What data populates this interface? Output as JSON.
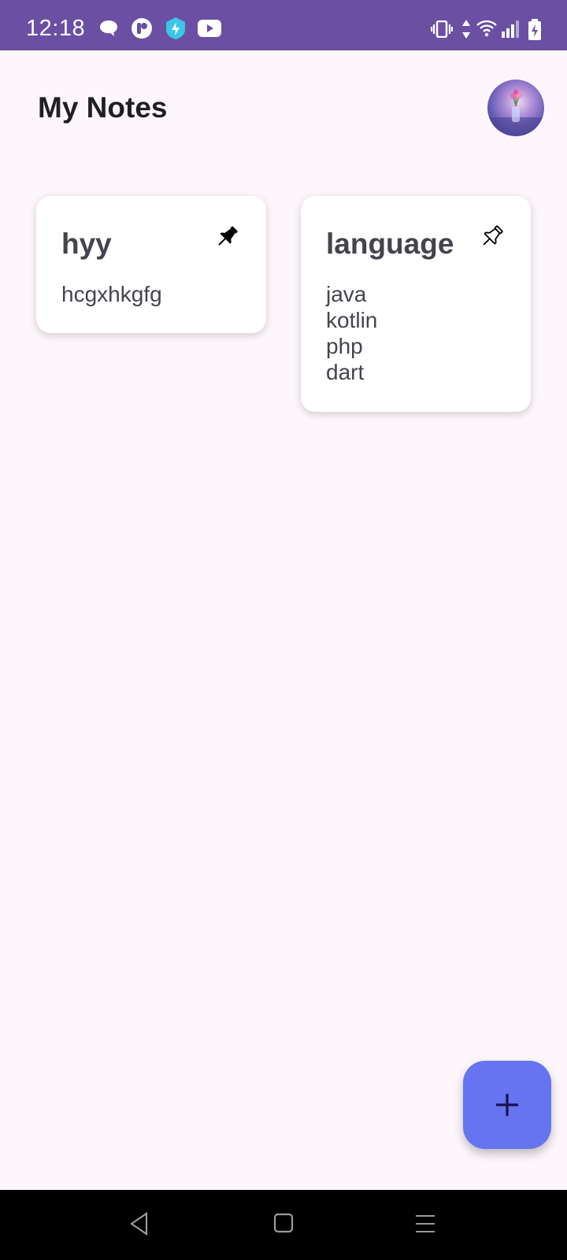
{
  "status_bar": {
    "time": "12:18",
    "left_icons": [
      "chat-bubble-icon",
      "p-app-icon",
      "bolt-shield-icon",
      "youtube-icon"
    ],
    "right_icons": [
      "vibrate-icon",
      "data-arrows-icon",
      "wifi-icon",
      "signal-icon",
      "battery-charging-icon"
    ]
  },
  "header": {
    "title": "My Notes",
    "avatar_icon": "profile-avatar"
  },
  "notes": [
    {
      "title": "hyy",
      "lines": [
        "hcgxhkgfg"
      ],
      "pinned": true
    },
    {
      "title": "language",
      "lines": [
        "java",
        "kotlin",
        "php",
        "dart"
      ],
      "pinned": false
    }
  ],
  "fab": {
    "icon": "plus-icon",
    "color": "#6674ef"
  },
  "nav_bar": {
    "buttons": [
      "back-icon",
      "home-icon",
      "recents-icon"
    ]
  },
  "colors": {
    "status_bar": "#6a4fa3",
    "background": "#fdf7fc",
    "card": "#ffffff",
    "text": "#45444d"
  }
}
